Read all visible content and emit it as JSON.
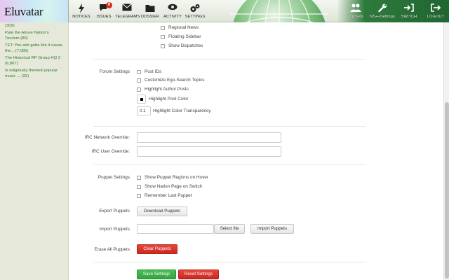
{
  "app": {
    "logo": "Eluvatar"
  },
  "nav": [
    {
      "label": "NOTICES",
      "icon": "lightning-icon"
    },
    {
      "label": "ISSUES",
      "icon": "chat-icon",
      "badge": "0"
    },
    {
      "label": "TELEGRAMS",
      "icon": "envelope-icon"
    },
    {
      "label": "DOSSIER",
      "icon": "folder-icon"
    },
    {
      "label": "ACTIVITY",
      "icon": "eye-icon"
    },
    {
      "label": "SETTINGS",
      "icon": "gears-icon"
    }
  ],
  "nav_right": [
    {
      "label": "Puppets",
      "icon": "people-icon"
    },
    {
      "label": "NS++Settings",
      "icon": "wrench-icon"
    },
    {
      "label": "SWITCH",
      "icon": "switch-icon"
    },
    {
      "label": "LOGOUT",
      "icon": "logout-icon"
    }
  ],
  "sidebar": {
    "items": [
      {
        "lines": [
          "(309)"
        ]
      },
      {
        "lines": [
          "Pate the Above Nation's",
          "Tourism (89)"
        ]
      },
      {
        "lines": [
          "TET: You aint gotta like it cause",
          "the... (7,086)"
        ]
      },
      {
        "lines": [
          "The Historical RP Group HQ 2",
          "(6,867)"
        ]
      },
      {
        "lines": [
          "Is religiously themed popular",
          "music ... (32)"
        ]
      }
    ]
  },
  "settings": {
    "top_checkboxes": [
      "Regional News",
      "Floating Sidebar",
      "Show Dispatches"
    ],
    "forum": {
      "label": "Forum Settings",
      "checkboxes": [
        "Post IDs",
        "Customize Ego-Search Topics",
        "Highlight Author Posts"
      ],
      "highlight_color_label": "Highlight Post Color",
      "transparency_value": "0.1",
      "transparency_label": "Highlight Color Transparency"
    },
    "irc": {
      "network_label": "IRC Network Override:",
      "user_label": "IRC User Override:"
    },
    "puppet": {
      "label": "Puppet Settings",
      "checkboxes": [
        "Show Puppet Regions on Hover",
        "Show Nation Page on Switch",
        "Remember Last Puppet"
      ]
    },
    "export": {
      "label": "Export Puppets",
      "button": "Download Puppets"
    },
    "import": {
      "label": "Import Puppets",
      "select_button": "Select file",
      "import_button": "Import Puppets"
    },
    "erase": {
      "label": "Erase All Puppets",
      "button": "Clear Puppets"
    },
    "save_button": "Save Settings",
    "reset_button": "Reset Settings"
  },
  "colors": {
    "accent_green": "#2e7d2a",
    "danger": "#c9281f",
    "success": "#35a23e",
    "badge": "#d9281d"
  }
}
